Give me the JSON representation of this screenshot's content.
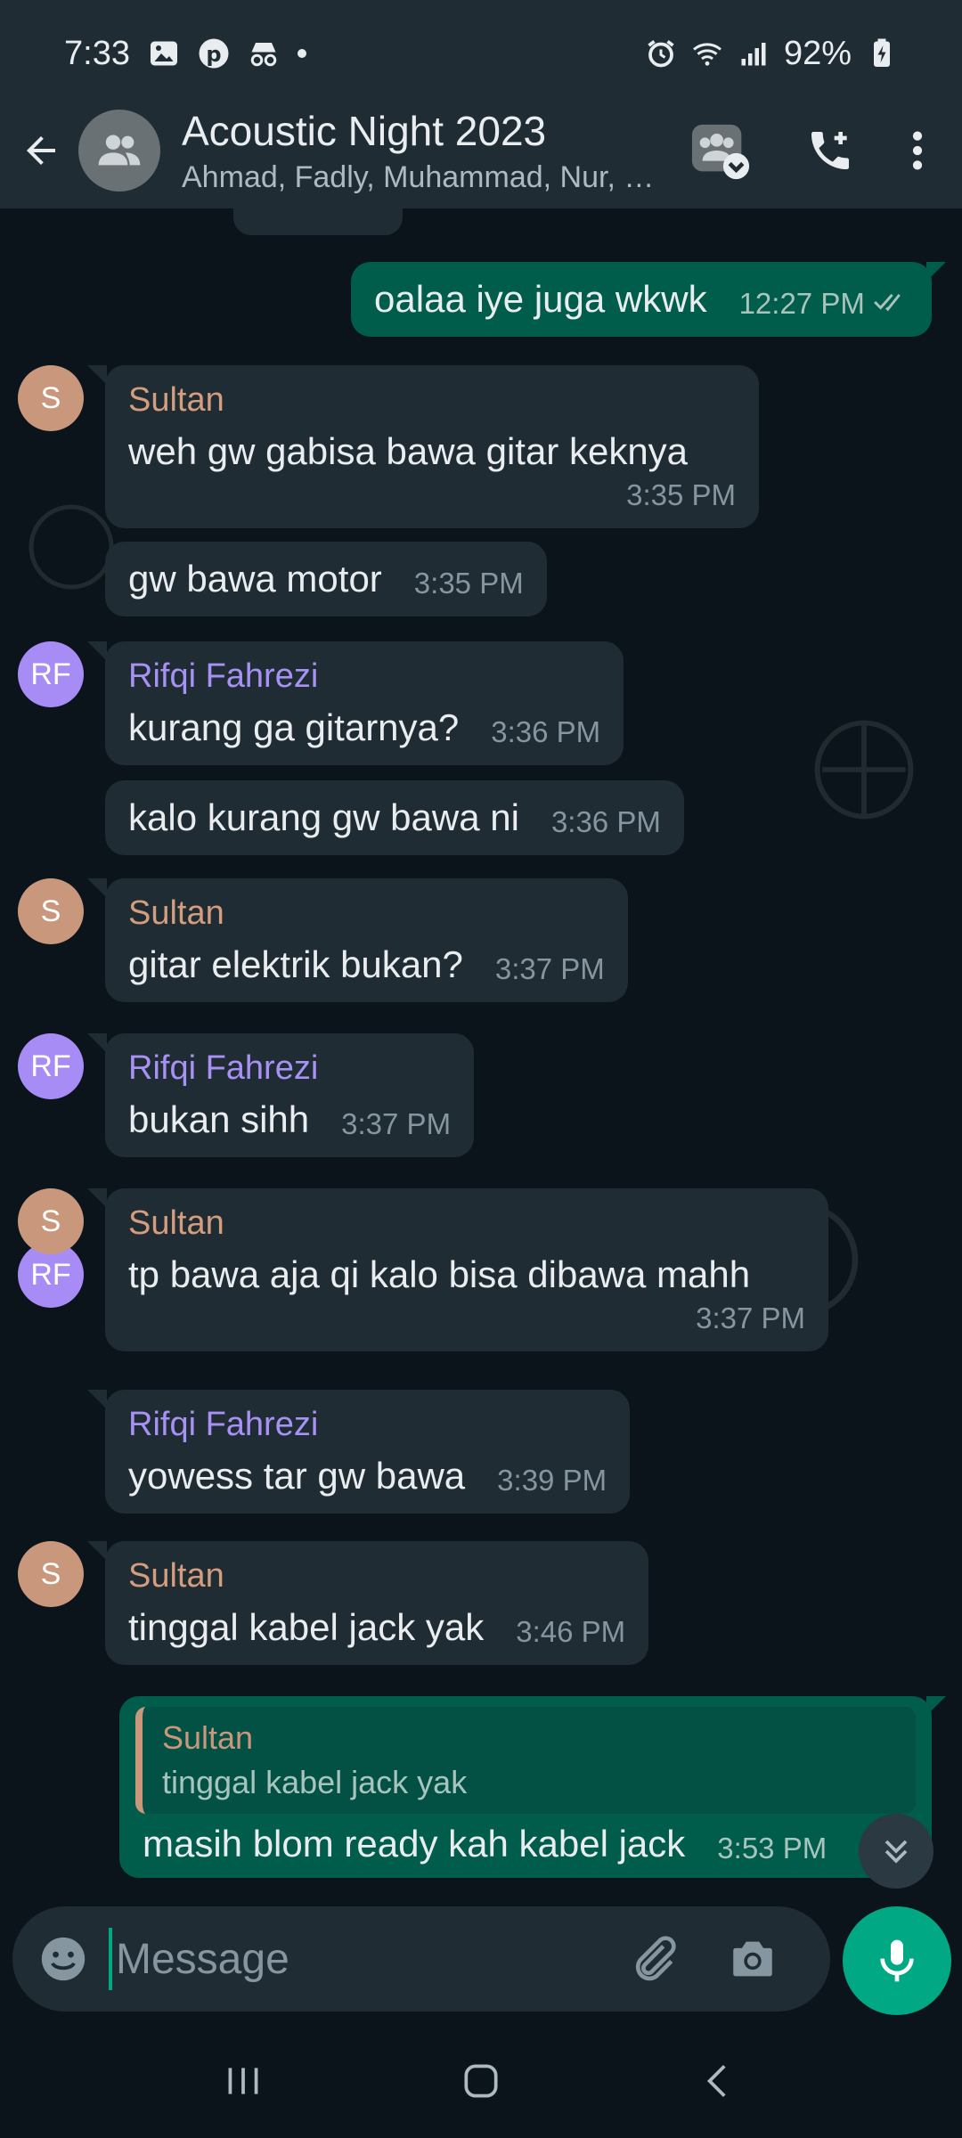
{
  "status_bar": {
    "time": "7:33",
    "battery": "92%"
  },
  "header": {
    "title": "Acoustic Night 2023",
    "subtitle": "Ahmad, Fadly, Muhammad, Nur, Rifqi Fahrezi, Sultan, You"
  },
  "messages": [
    {
      "type": "out",
      "text": "oalaa iye juga wkwk",
      "time": "12:27 PM",
      "status": "read"
    },
    {
      "type": "in",
      "sender": "Sultan",
      "initials": "S",
      "text": "weh gw gabisa bawa gitar keknya",
      "time": "3:35 PM"
    },
    {
      "type": "in",
      "text": "gw bawa motor",
      "time": "3:35 PM"
    },
    {
      "type": "in",
      "sender": "Rifqi Fahrezi",
      "initials": "RF",
      "text": "kurang ga gitarnya?",
      "time": "3:36 PM"
    },
    {
      "type": "in",
      "text": "kalo kurang gw bawa ni",
      "time": "3:36 PM"
    },
    {
      "type": "in",
      "sender": "Sultan",
      "initials": "S",
      "text": "gitar elektrik bukan?",
      "time": "3:37 PM"
    },
    {
      "type": "in",
      "sender": "Rifqi Fahrezi",
      "initials": "RF",
      "text": "bukan sihh",
      "time": "3:37 PM"
    },
    {
      "type": "in",
      "sender": "Sultan",
      "initials": "S",
      "text": "tp bawa aja qi kalo bisa dibawa mahh",
      "time": "3:37 PM"
    },
    {
      "type": "in",
      "sender": "Rifqi Fahrezi",
      "initials": "RF",
      "text": "yowess tar gw bawa",
      "time": "3:39 PM"
    },
    {
      "type": "in",
      "sender": "Sultan",
      "initials": "S",
      "text": "tinggal kabel jack yak",
      "time": "3:46 PM"
    },
    {
      "type": "out",
      "quote_name": "Sultan",
      "quote_text": "tinggal kabel jack yak",
      "text": "masih blom ready kah kabel jack",
      "time": "3:53 PM"
    }
  ],
  "input": {
    "placeholder": "Message"
  },
  "colors": {
    "accent": "#00a884",
    "outgoing": "#005c4b",
    "incoming": "#202c33",
    "sultan": "#d49d7d",
    "rifqi": "#a791f5"
  }
}
